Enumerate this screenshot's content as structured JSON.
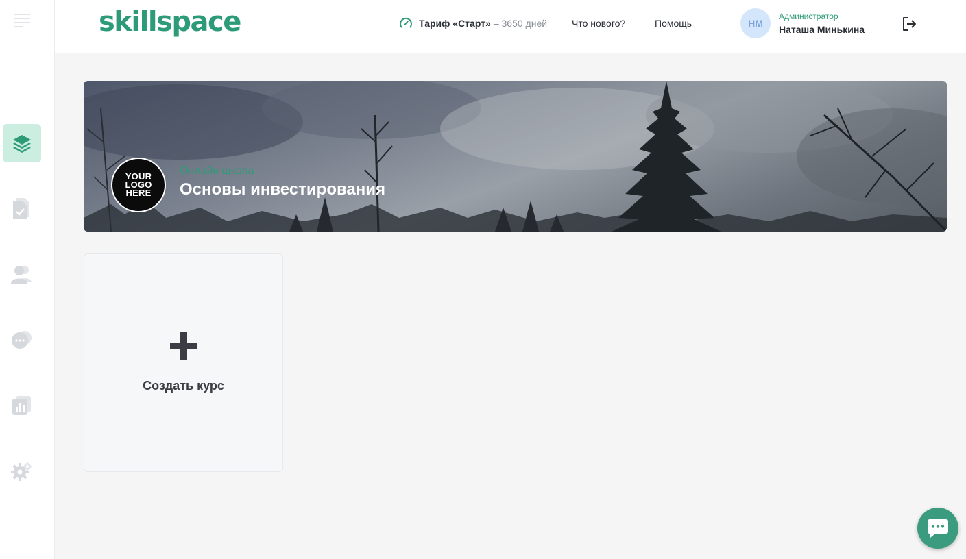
{
  "brand": {
    "logo_text": "skillspace",
    "accent_color": "#2e9b78"
  },
  "sidebar": {
    "items": [
      {
        "name": "courses",
        "icon": "layers-icon",
        "active": true
      },
      {
        "name": "homework",
        "icon": "document-check-icon",
        "active": false
      },
      {
        "name": "students",
        "icon": "users-icon",
        "active": false
      },
      {
        "name": "messages",
        "icon": "chat-bubbles-icon",
        "active": false
      },
      {
        "name": "analytics",
        "icon": "chart-icon",
        "active": false
      },
      {
        "name": "settings",
        "icon": "gear-icon",
        "active": false
      }
    ]
  },
  "header": {
    "tariff_label": "Тариф «Старт»",
    "tariff_days": "– 3650 дней",
    "whats_new": "Что нового?",
    "help": "Помощь",
    "user": {
      "initials": "НМ",
      "role": "Администратор",
      "name": "Наташа Минькина"
    }
  },
  "banner": {
    "logo_text": "YOUR\nLOGO\nHERE",
    "subtitle": "Онлайн школа",
    "title": "Основы инвестирования"
  },
  "create_card": {
    "label": "Создать курс"
  }
}
